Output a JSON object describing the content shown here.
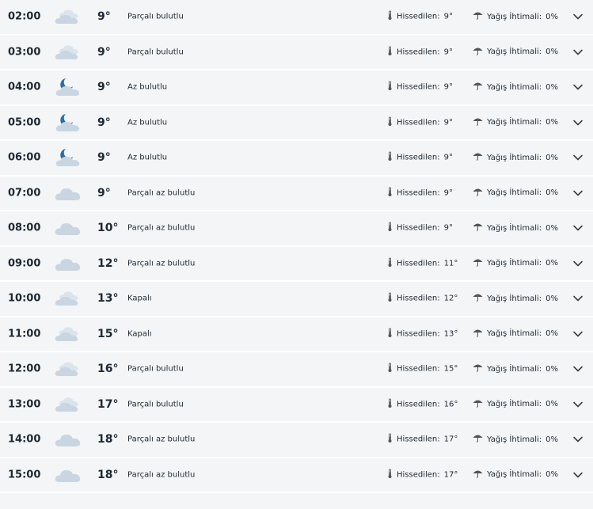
{
  "labels": {
    "feels": "Hissedilen:",
    "rain": "Yağış İhtimali:"
  },
  "colors": {
    "cloud": "#c9d6e1",
    "moon": "#2e6da4",
    "text": "#1f2933",
    "row_bg": "#f3f5f7"
  },
  "rows": [
    {
      "time": "02:00",
      "icon": "overcast-clouds-icon",
      "temp": "9°",
      "condition": "Parçalı bulutlu",
      "feels": "9°",
      "rain": "0%"
    },
    {
      "time": "03:00",
      "icon": "overcast-clouds-icon",
      "temp": "9°",
      "condition": "Parçalı bulutlu",
      "feels": "9°",
      "rain": "0%"
    },
    {
      "time": "04:00",
      "icon": "moon-cloud-icon",
      "temp": "9°",
      "condition": "Az bulutlu",
      "feels": "9°",
      "rain": "0%"
    },
    {
      "time": "05:00",
      "icon": "moon-cloud-icon",
      "temp": "9°",
      "condition": "Az bulutlu",
      "feels": "9°",
      "rain": "0%"
    },
    {
      "time": "06:00",
      "icon": "moon-cloud-icon",
      "temp": "9°",
      "condition": "Az bulutlu",
      "feels": "9°",
      "rain": "0%"
    },
    {
      "time": "07:00",
      "icon": "cloud-icon",
      "temp": "9°",
      "condition": "Parçalı az bulutlu",
      "feels": "9°",
      "rain": "0%"
    },
    {
      "time": "08:00",
      "icon": "cloud-icon",
      "temp": "10°",
      "condition": "Parçalı az bulutlu",
      "feels": "9°",
      "rain": "0%"
    },
    {
      "time": "09:00",
      "icon": "cloud-icon",
      "temp": "12°",
      "condition": "Parçalı az bulutlu",
      "feels": "11°",
      "rain": "0%"
    },
    {
      "time": "10:00",
      "icon": "overcast-clouds-icon",
      "temp": "13°",
      "condition": "Kapalı",
      "feels": "12°",
      "rain": "0%"
    },
    {
      "time": "11:00",
      "icon": "overcast-clouds-icon",
      "temp": "15°",
      "condition": "Kapalı",
      "feels": "13°",
      "rain": "0%"
    },
    {
      "time": "12:00",
      "icon": "overcast-clouds-icon",
      "temp": "16°",
      "condition": "Parçalı bulutlu",
      "feels": "15°",
      "rain": "0%"
    },
    {
      "time": "13:00",
      "icon": "overcast-clouds-icon",
      "temp": "17°",
      "condition": "Parçalı bulutlu",
      "feels": "16°",
      "rain": "0%"
    },
    {
      "time": "14:00",
      "icon": "cloud-icon",
      "temp": "18°",
      "condition": "Parçalı az bulutlu",
      "feels": "17°",
      "rain": "0%"
    },
    {
      "time": "15:00",
      "icon": "cloud-icon",
      "temp": "18°",
      "condition": "Parçalı az bulutlu",
      "feels": "17°",
      "rain": "0%"
    }
  ]
}
